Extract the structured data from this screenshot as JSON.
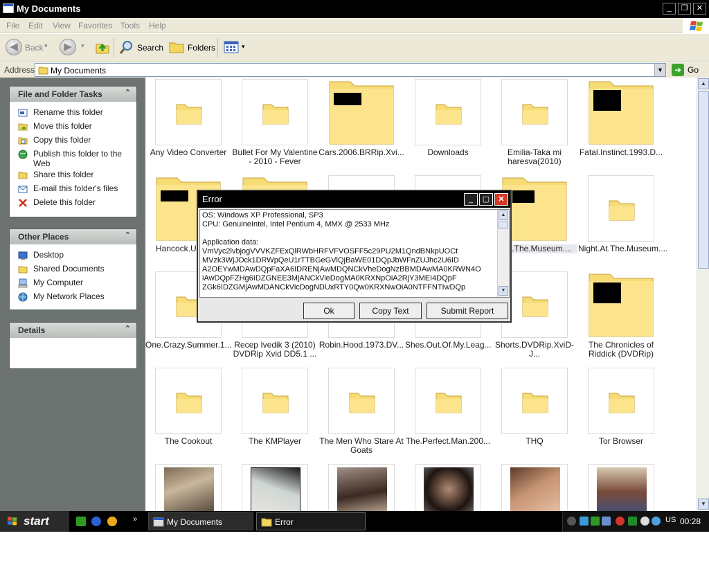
{
  "window": {
    "title": "My Documents",
    "controls": {
      "minimize": "_",
      "maximize": "❐",
      "close": "✕"
    }
  },
  "menu": [
    "File",
    "Edit",
    "View",
    "Favorites",
    "Tools",
    "Help"
  ],
  "toolbar": {
    "back_label": "Back",
    "search_label": "Search",
    "folders_label": "Folders"
  },
  "address": {
    "label": "Address",
    "value": "My Documents",
    "go_label": "Go"
  },
  "sidebar": {
    "tasks": {
      "title": "File and Folder Tasks",
      "items": [
        "Rename this folder",
        "Move this folder",
        "Copy this folder",
        "Publish this folder to the Web",
        "Share this folder",
        "E-mail this folder's files",
        "Delete this folder"
      ]
    },
    "places": {
      "title": "Other Places",
      "items": [
        "Desktop",
        "Shared Documents",
        "My Computer",
        "My Network Places"
      ]
    },
    "details": {
      "title": "Details"
    }
  },
  "files": [
    "Any Video Converter",
    "Bullet For My Valentine - 2010 - Fever",
    "Cars.2006.BRRip.Xvi...",
    "Downloads",
    "Emilia-Taka mi haresva(2010)",
    "Fatal.Instinct.1993.D...",
    "Hancock.UNRA...",
    "",
    "",
    "",
    "...At.The.Museum....",
    "Night.At.The.Museum....",
    "One.Crazy.Summer.1...",
    "Recep Ivedik 3 (2010) DVDRip Xvid DD5.1 ...",
    "Robin.Hood.1973.DV...",
    "Shes.Out.Of.My.Leag...",
    "Shorts.DVDRip.XviD-J...",
    "The Chronicles of Riddick (DVDRip)",
    "The Cookout",
    "The KMPlayer",
    "The Men Who Stare At Goats",
    "The.Perfect.Man.200...",
    "THQ",
    "Tor Browser"
  ],
  "dialog": {
    "title": "Error",
    "lines": [
      "OS: Windows XP Professional, SP3",
      "CPU: GenuineIntel, Intel Pentium 4, MMX @ 2533 MHz",
      "",
      "Application data:",
      "VmVyc2lvbjogVVVKZFExQlRWbHRFVFVOSFF5c29PU2M1QndBNkpUOCt",
      "MVzk3WjJOck1DRWpQeU1rTTBGeGVlQjBaWE01DQpJbWFnZUJhc2U6ID",
      "A2OEYwMDAwDQpFaXA6IDRENjAwMDQNCkVheDogNzBBMDAwMA0KRWN4O",
      "iAwDQpFZHg6IDZGNEE3MjANCkVieDogMA0KRXNpOiA2RjY3MEI4DQpF",
      "ZGk6IDZGMjAwMDANCkVicDogNDUxRTY0Qw0KRXNwOiA0NTFFNTIwDQp"
    ],
    "buttons": {
      "ok": "Ok",
      "copy": "Copy Text",
      "submit": "Submit Report"
    }
  },
  "taskbar": {
    "start": "start",
    "tasks": [
      "My Documents",
      "Error"
    ],
    "language": "US",
    "clock": "00:28"
  }
}
